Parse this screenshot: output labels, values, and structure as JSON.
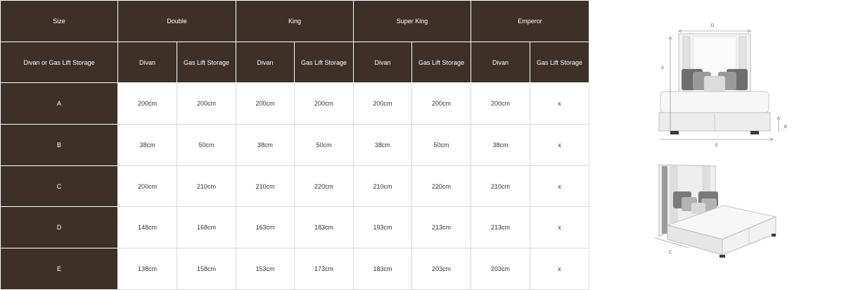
{
  "table": {
    "header_row_1": {
      "label": "Size",
      "groups": [
        "Double",
        "King",
        "Super King",
        "Emperor"
      ]
    },
    "header_row_2": {
      "label": "Divan or Gas Lift Storage",
      "columns": [
        "Divan",
        "Gas Lift Storage",
        "Divan",
        "Gas Lift Storage",
        "Divan",
        "Gas Lift Storage",
        "Divan",
        "Gas Lift Storage"
      ]
    },
    "rows": [
      {
        "label": "A",
        "values": [
          "200cm",
          "200cm",
          "200cm",
          "200cm",
          "200cm",
          "200cm",
          "200cm",
          "x"
        ]
      },
      {
        "label": "B",
        "values": [
          "38cm",
          "50cm",
          "38cm",
          "50cm",
          "38cm",
          "50cm",
          "38cm",
          "x"
        ]
      },
      {
        "label": "C",
        "values": [
          "200cm",
          "210cm",
          "210cm",
          "220cm",
          "210cm",
          "220cm",
          "210cm",
          "x"
        ]
      },
      {
        "label": "D",
        "values": [
          "148cm",
          "168cm",
          "163cm",
          "183cm",
          "193cm",
          "213cm",
          "213cm",
          "x"
        ]
      },
      {
        "label": "E",
        "values": [
          "138cm",
          "158cm",
          "153cm",
          "173cm",
          "183cm",
          "203cm",
          "203cm",
          "x"
        ]
      }
    ]
  },
  "diagram": {
    "front_labels": {
      "d": "D",
      "a": "A",
      "b": "B",
      "e": "E"
    },
    "side_labels": {
      "c": "C"
    }
  },
  "colors": {
    "header_brown": "#3d3127",
    "grid_line": "#d9d9d9"
  }
}
